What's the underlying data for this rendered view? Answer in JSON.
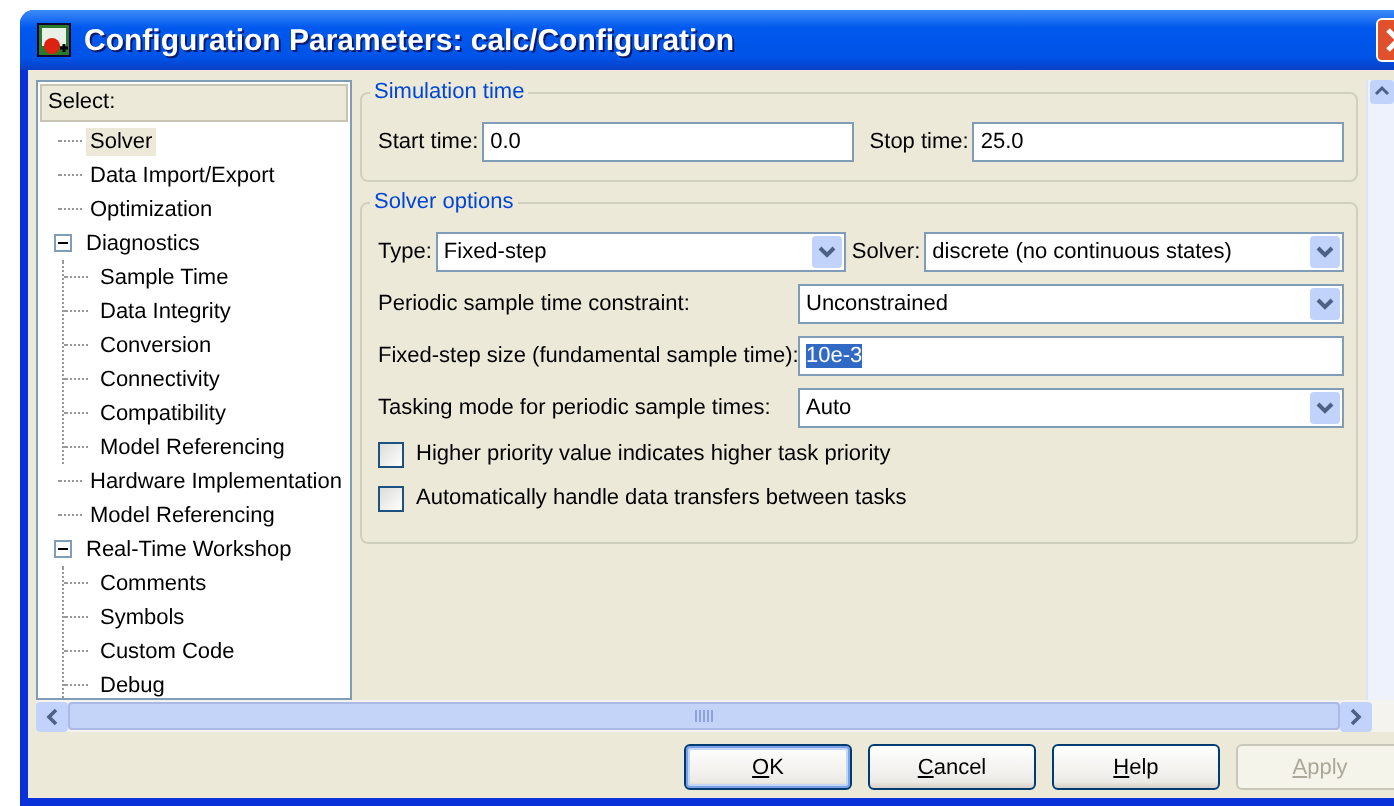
{
  "window": {
    "title": "Configuration Parameters: calc/Configuration"
  },
  "tree": {
    "header": "Select:",
    "items": [
      {
        "label": "Solver",
        "selected": true
      },
      {
        "label": "Data Import/Export",
        "selected": false
      },
      {
        "label": "Optimization",
        "selected": false
      },
      {
        "label": "Diagnostics",
        "selected": false,
        "expanded": true,
        "children": [
          {
            "label": "Sample Time",
            "selected": false
          },
          {
            "label": "Data Integrity",
            "selected": false
          },
          {
            "label": "Conversion",
            "selected": false
          },
          {
            "label": "Connectivity",
            "selected": false
          },
          {
            "label": "Compatibility",
            "selected": false
          },
          {
            "label": "Model Referencing",
            "selected": false
          }
        ]
      },
      {
        "label": "Hardware Implementation",
        "selected": false
      },
      {
        "label": "Model Referencing",
        "selected": false
      },
      {
        "label": "Real-Time Workshop",
        "selected": false,
        "expanded": true,
        "children": [
          {
            "label": "Comments",
            "selected": false
          },
          {
            "label": "Symbols",
            "selected": false
          },
          {
            "label": "Custom Code",
            "selected": false
          },
          {
            "label": "Debug",
            "selected": false
          }
        ]
      }
    ]
  },
  "simulation_time": {
    "title": "Simulation time",
    "start_time": {
      "label": "Start time:",
      "value": "0.0"
    },
    "stop_time": {
      "label": "Stop time:",
      "value": "25.0"
    }
  },
  "solver_options": {
    "title": "Solver options",
    "type": {
      "label": "Type:",
      "value": "Fixed-step"
    },
    "solver": {
      "label": "Solver:",
      "value": "discrete (no continuous states)"
    },
    "rows": [
      {
        "kind": "dropdown",
        "label": "Periodic sample time constraint:",
        "value": "Unconstrained"
      },
      {
        "kind": "text",
        "label": "Fixed-step size (fundamental sample time):",
        "value": "10e-3",
        "value_selected": true
      },
      {
        "kind": "dropdown",
        "label": "Tasking mode for periodic sample times:",
        "value": "Auto"
      }
    ],
    "checkboxes": [
      {
        "label": "Higher priority value indicates higher task priority",
        "checked": false
      },
      {
        "label": "Automatically handle data transfers between tasks",
        "checked": false
      }
    ]
  },
  "buttons": [
    {
      "label": "OK",
      "default": true,
      "disabled": false
    },
    {
      "label": "Cancel",
      "default": false,
      "disabled": false
    },
    {
      "label": "Help",
      "default": false,
      "disabled": false
    },
    {
      "label": "Apply",
      "default": false,
      "disabled": true
    }
  ]
}
